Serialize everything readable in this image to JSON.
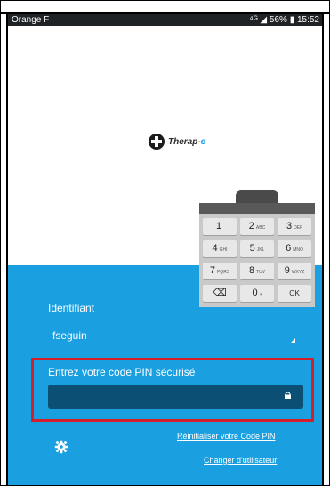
{
  "status_bar": {
    "carrier": "Orange F",
    "right_text": "⁴ᴳ ◢ 56% ▮ 15:52"
  },
  "app": {
    "logo_text_main": "Therap-",
    "logo_text_e": "e"
  },
  "login": {
    "identifiant_label": "Identifiant",
    "username": "fseguin",
    "pin_label": "Entrez votre code PIN sécurisé",
    "reset_link": "Réinitialiser votre Code PIN",
    "change_user_link": "Changer d'utilisateur"
  },
  "keypad": {
    "keys": [
      {
        "main": "1",
        "sub": ""
      },
      {
        "main": "2",
        "sub": "ABC"
      },
      {
        "main": "3",
        "sub": "DEF"
      },
      {
        "main": "4",
        "sub": "GHI"
      },
      {
        "main": "5",
        "sub": "JKL"
      },
      {
        "main": "6",
        "sub": "MNO"
      },
      {
        "main": "7",
        "sub": "PQRS"
      },
      {
        "main": "8",
        "sub": "TUV"
      },
      {
        "main": "9",
        "sub": "WXYZ"
      },
      {
        "main": "⌫",
        "sub": ""
      },
      {
        "main": "0",
        "sub": "+"
      },
      {
        "main": "OK",
        "sub": ""
      }
    ]
  }
}
